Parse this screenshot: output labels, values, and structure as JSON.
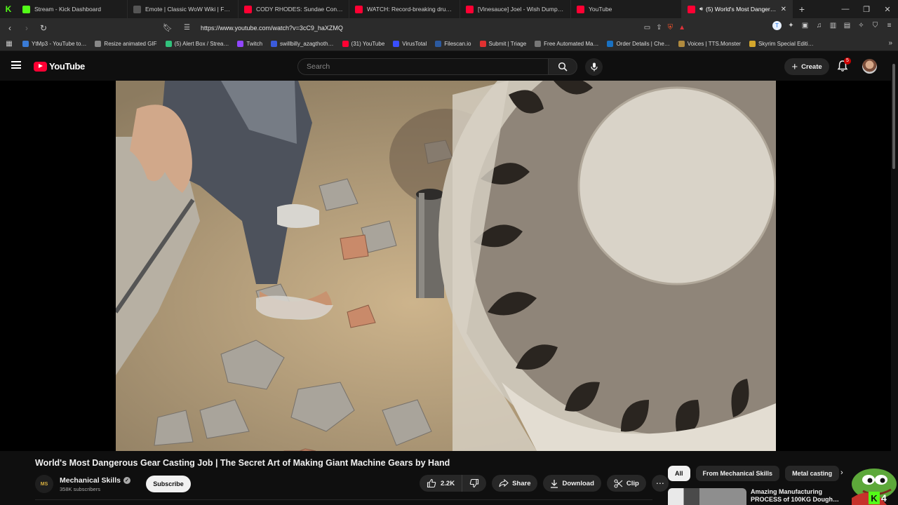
{
  "browser": {
    "tabs": [
      {
        "title": "Stream - Kick Dashboard",
        "favicon": "kick-icon",
        "color": "#53fc18"
      },
      {
        "title": "Emote | Classic WoW Wiki | Fandom",
        "favicon": "fandom-icon",
        "color": "#555555"
      },
      {
        "title": "CODY RHODES: Sundae Conversati…",
        "favicon": "youtube-icon",
        "color": "#ff0033"
      },
      {
        "title": "WATCH: Record-breaking drug load…",
        "favicon": "youtube-icon",
        "color": "#ff0033"
      },
      {
        "title": "[Vinesauce] Joel - Wish Dumpster D…",
        "favicon": "youtube-icon",
        "color": "#ff0033"
      },
      {
        "title": "YouTube",
        "favicon": "youtube-icon",
        "color": "#ff0033"
      },
      {
        "title": "(5) World's Most Dangerous…",
        "favicon": "youtube-icon",
        "color": "#ff0033",
        "active": true
      }
    ],
    "url": "https://www.youtube.com/watch?v=3cC9_haXZMQ",
    "bookmarks": [
      {
        "label": "YtMp3 - YouTube to…",
        "color": "#3a7bd5"
      },
      {
        "label": "Resize animated GIF",
        "color": "#888888"
      },
      {
        "label": "(5) Alert Box / Strea…",
        "color": "#31c27c"
      },
      {
        "label": "Twitch",
        "color": "#9146ff"
      },
      {
        "label": "swillbilly_azagthoth…",
        "color": "#3b5bdb"
      },
      {
        "label": "(31) YouTube",
        "color": "#ff0033"
      },
      {
        "label": "VirusTotal",
        "color": "#394eff"
      },
      {
        "label": "Filescan.io",
        "color": "#2c5aa0"
      },
      {
        "label": "Submit | Triage",
        "color": "#e03131"
      },
      {
        "label": "Free Automated Ma…",
        "color": "#777777"
      },
      {
        "label": "Order Details | Che…",
        "color": "#1971c2"
      },
      {
        "label": "Voices | TTS.Monster",
        "color": "#b08a3e"
      },
      {
        "label": "Skyrim Special Editi…",
        "color": "#d4a72c"
      }
    ]
  },
  "youtube": {
    "logo_text": "YouTube",
    "search_placeholder": "Search",
    "create_label": "Create",
    "notification_count": "5",
    "video": {
      "title": "World's Most Dangerous Gear Casting Job | The Secret Art of Making Giant Machine Gears by Hand",
      "channel_name": "Mechanical Skills",
      "channel_avatar_text": "MS",
      "subscribers": "358K subscribers",
      "subscribe_label": "Subscribe",
      "likes": "2.2K",
      "share_label": "Share",
      "download_label": "Download",
      "clip_label": "Clip"
    },
    "chips": [
      "All",
      "From Mechanical Skills",
      "Metal casting"
    ],
    "recommendation": {
      "title": "Amazing Manufacturing PROCESS of 100KG Dough…"
    }
  },
  "overlay": {
    "kick_count": "4"
  },
  "colors": {
    "youtube_red": "#ff0033",
    "kick_green": "#53fc18",
    "background": "#0f0f0f"
  }
}
